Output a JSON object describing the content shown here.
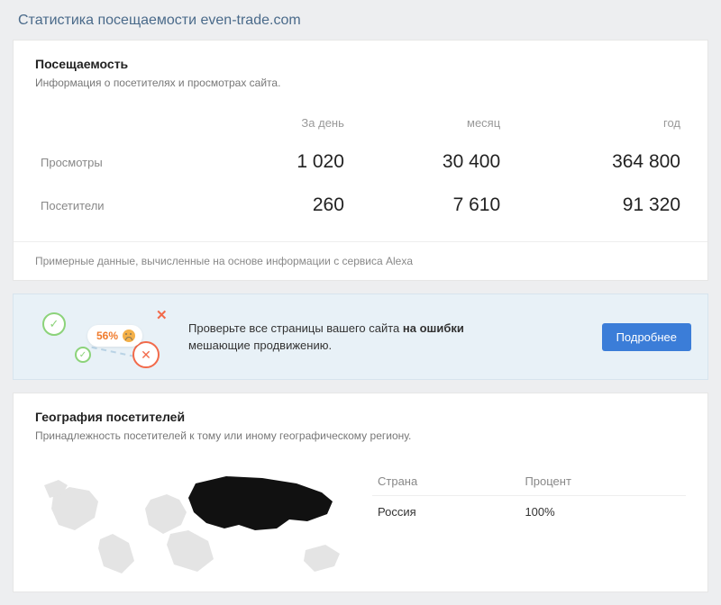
{
  "page_title": "Статистика посещаемости even-trade.com",
  "traffic": {
    "heading": "Посещаемость",
    "subtitle": "Информация о посетителях и просмотрах сайта.",
    "columns": {
      "day": "За день",
      "month": "месяц",
      "year": "год"
    },
    "rows": [
      {
        "label": "Просмотры",
        "day": "1 020",
        "month": "30 400",
        "year": "364 800"
      },
      {
        "label": "Посетители",
        "day": "260",
        "month": "7 610",
        "year": "91 320"
      }
    ],
    "footnote": "Примерные данные, вычисленные на основе информации с сервиса Alexa"
  },
  "banner": {
    "percent": "56%",
    "text_pre": "Проверьте все страницы вашего сайта ",
    "text_bold": "на ошибки",
    "text_post": " мешающие продвижению.",
    "button": "Подробнее"
  },
  "geo": {
    "heading": "География посетителей",
    "subtitle": "Принадлежность посетителей к тому или иному географическому региону.",
    "headers": {
      "country": "Страна",
      "percent": "Процент"
    },
    "rows": [
      {
        "country": "Россия",
        "percent": "100%"
      }
    ]
  }
}
